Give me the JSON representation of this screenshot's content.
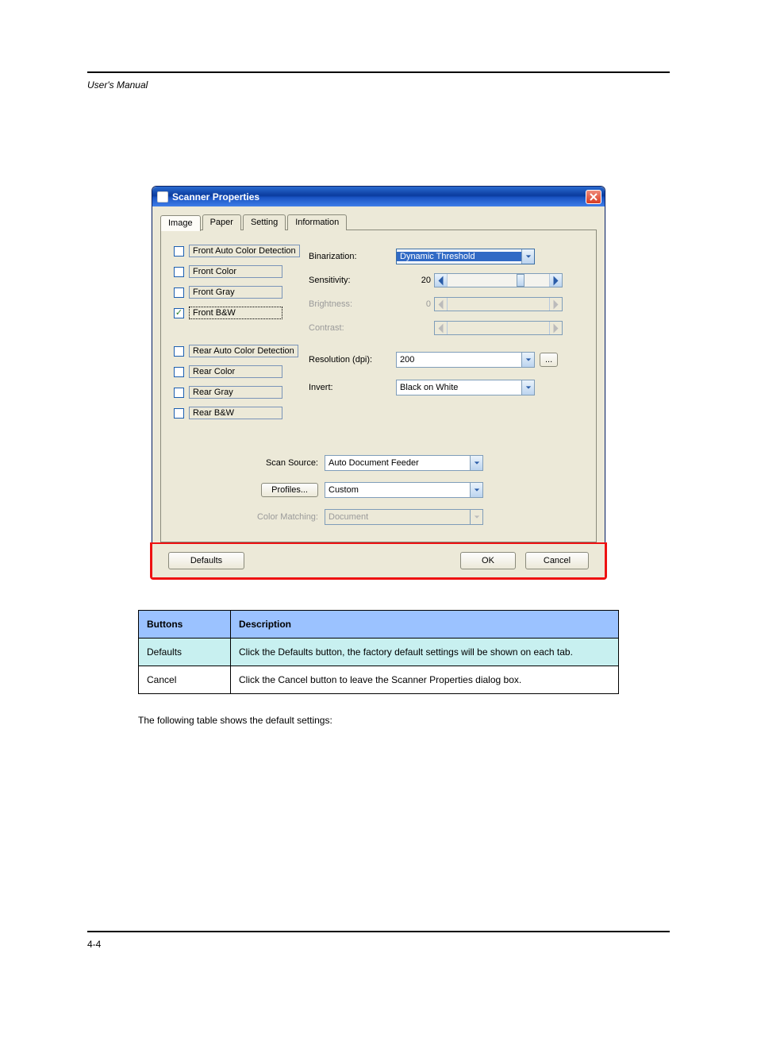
{
  "header": {
    "left": "User's Manual",
    "right": ""
  },
  "footer": {
    "page": "4-4"
  },
  "dialog": {
    "title": "Scanner Properties",
    "tabs": [
      "Image",
      "Paper",
      "Setting",
      "Information"
    ],
    "active_tab": 0,
    "image_sides": [
      {
        "label": "Front Auto Color Detection",
        "checked": false
      },
      {
        "label": "Front Color",
        "checked": false
      },
      {
        "label": "Front Gray",
        "checked": false
      },
      {
        "label": "Front B&W",
        "checked": true,
        "current": true
      },
      {
        "label": "Rear Auto Color Detection",
        "checked": false
      },
      {
        "label": "Rear Color",
        "checked": false
      },
      {
        "label": "Rear Gray",
        "checked": false
      },
      {
        "label": "Rear B&W",
        "checked": false
      }
    ],
    "options": {
      "binarization": {
        "label": "Binarization:",
        "value": "Dynamic Threshold"
      },
      "sensitivity": {
        "label": "Sensitivity:",
        "value": "20",
        "thumb_pct": 68
      },
      "brightness": {
        "label": "Brightness:",
        "value": "0",
        "disabled": true
      },
      "contrast": {
        "label": "Contrast:",
        "value": "",
        "disabled": true
      },
      "resolution": {
        "label": "Resolution (dpi):",
        "value": "200",
        "more": "..."
      },
      "invert": {
        "label": "Invert:",
        "value": "Black on White"
      }
    },
    "bottom": {
      "scan_source": {
        "label": "Scan Source:",
        "value": "Auto Document Feeder"
      },
      "profiles": {
        "button": "Profiles...",
        "value": "Custom"
      },
      "color_matching": {
        "label": "Color Matching:",
        "value": "Document",
        "disabled": true
      }
    },
    "buttons": {
      "defaults": "Defaults",
      "ok": "OK",
      "cancel": "Cancel"
    }
  },
  "table": {
    "head": [
      "Buttons",
      "Description"
    ],
    "rows": [
      [
        "Defaults",
        "Click the Defaults button, the factory default settings will be shown on each tab."
      ],
      [
        "Cancel",
        "Click the Cancel button to leave the Scanner Properties dialog box."
      ]
    ]
  },
  "caption": "The following table shows the default settings:"
}
